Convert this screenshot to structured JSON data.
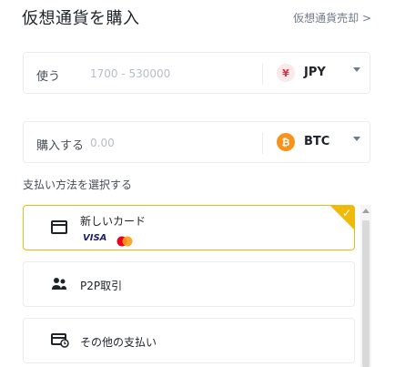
{
  "header": {
    "title": "仮想通貨を購入",
    "sell_link": "仮想通貨売却 >"
  },
  "spend": {
    "label": "使う",
    "placeholder": "1700 - 530000",
    "currency": "JPY",
    "currency_symbol": "¥"
  },
  "receive": {
    "label": "購入する",
    "placeholder": "0.00",
    "currency": "BTC",
    "currency_symbol": "₿"
  },
  "payment": {
    "section_label": "支払い方法を選択する",
    "options": [
      {
        "label": "新しいカード",
        "icon": "card-icon",
        "badges": [
          "VISA",
          "mastercard"
        ],
        "selected": true
      },
      {
        "label": "P2P取引",
        "icon": "users-icon",
        "selected": false
      },
      {
        "label": "その他の支払い",
        "icon": "other-payment-icon",
        "selected": false
      }
    ],
    "badge_visa": "VISA"
  },
  "colors": {
    "accent": "#f0b90b",
    "btc": "#f7931a",
    "jpy_bg": "#fbe8e8",
    "jpy_fg": "#d9344a"
  }
}
